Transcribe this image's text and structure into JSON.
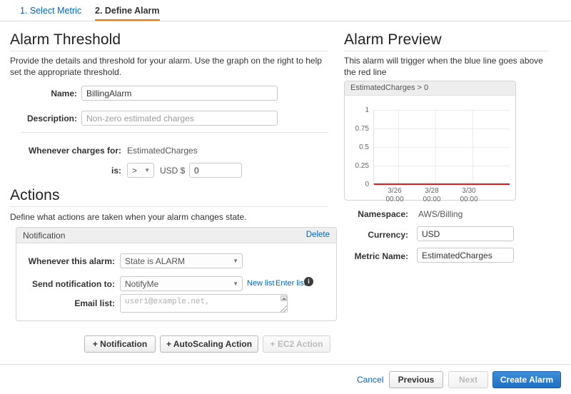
{
  "tabs": [
    {
      "label": "1. Select Metric",
      "active": false
    },
    {
      "label": "2. Define Alarm",
      "active": true
    }
  ],
  "threshold_section": {
    "heading": "Alarm Threshold",
    "description_line1": "Provide the details and threshold for your alarm. Use the graph on the right to help set the",
    "description_line2": "appropriate threshold.",
    "name_label": "Name:",
    "name_value": "BillingAlarm",
    "description_label": "Description:",
    "description_placeholder": "Non-zero estimated charges",
    "whenever_label": "Whenever charges for:",
    "whenever_value": "EstimatedCharges",
    "is_label": "is:",
    "comparison_value": ">",
    "currency_label": "USD $",
    "threshold_value": "0"
  },
  "actions_section": {
    "heading": "Actions",
    "description": "Define what actions are taken when your alarm changes state.",
    "notification": {
      "title": "Notification",
      "delete_label": "Delete",
      "whenever_label": "Whenever this alarm:",
      "whenever_value": "State is ALARM",
      "send_to_label": "Send notification to:",
      "send_to_value": "NotifyMe",
      "new_list_label": "New list",
      "enter_list_label": "Enter list",
      "info_glyph": "i",
      "email_label": "Email list:",
      "email_placeholder": "user1@example.net,"
    },
    "buttons": [
      {
        "label": "+ Notification",
        "disabled": false
      },
      {
        "label": "+ AutoScaling Action",
        "disabled": false
      },
      {
        "label": "+ EC2 Action",
        "disabled": true
      }
    ]
  },
  "preview_section": {
    "heading": "Alarm Preview",
    "description_line1": "This alarm will trigger when the blue line goes",
    "description_line2": "above the red line",
    "namespace_label": "Namespace:",
    "namespace_value": "AWS/Billing",
    "currency_label": "Currency:",
    "currency_value": "USD",
    "metric_label": "Metric Name:",
    "metric_value": "EstimatedCharges"
  },
  "chart_data": {
    "type": "line",
    "title": "EstimatedCharges > 0",
    "xlabel": "",
    "ylabel": "",
    "ylim": [
      0,
      1
    ],
    "yticks": [
      "0",
      "0.25",
      "0.5",
      "0.75",
      "1"
    ],
    "ytick_values": [
      0,
      0.25,
      0.5,
      0.75,
      1
    ],
    "xticks": [
      {
        "date": "3/26",
        "time": "00:00"
      },
      {
        "date": "3/28",
        "time": "00:00"
      },
      {
        "date": "3/30",
        "time": "00:00"
      }
    ],
    "grid": true,
    "legend": "none",
    "series": [
      {
        "name": "threshold",
        "type": "hline",
        "value": 0,
        "color": "#e8171c"
      }
    ]
  },
  "footer": {
    "cancel_label": "Cancel",
    "previous_label": "Previous",
    "next_label": "Next",
    "next_disabled": true,
    "create_label": "Create Alarm"
  },
  "colors": {
    "accent_orange": "#e47911",
    "link_blue": "#0066c0",
    "primary_blue": "#1f6fc4",
    "threshold_red": "#e8171c"
  }
}
